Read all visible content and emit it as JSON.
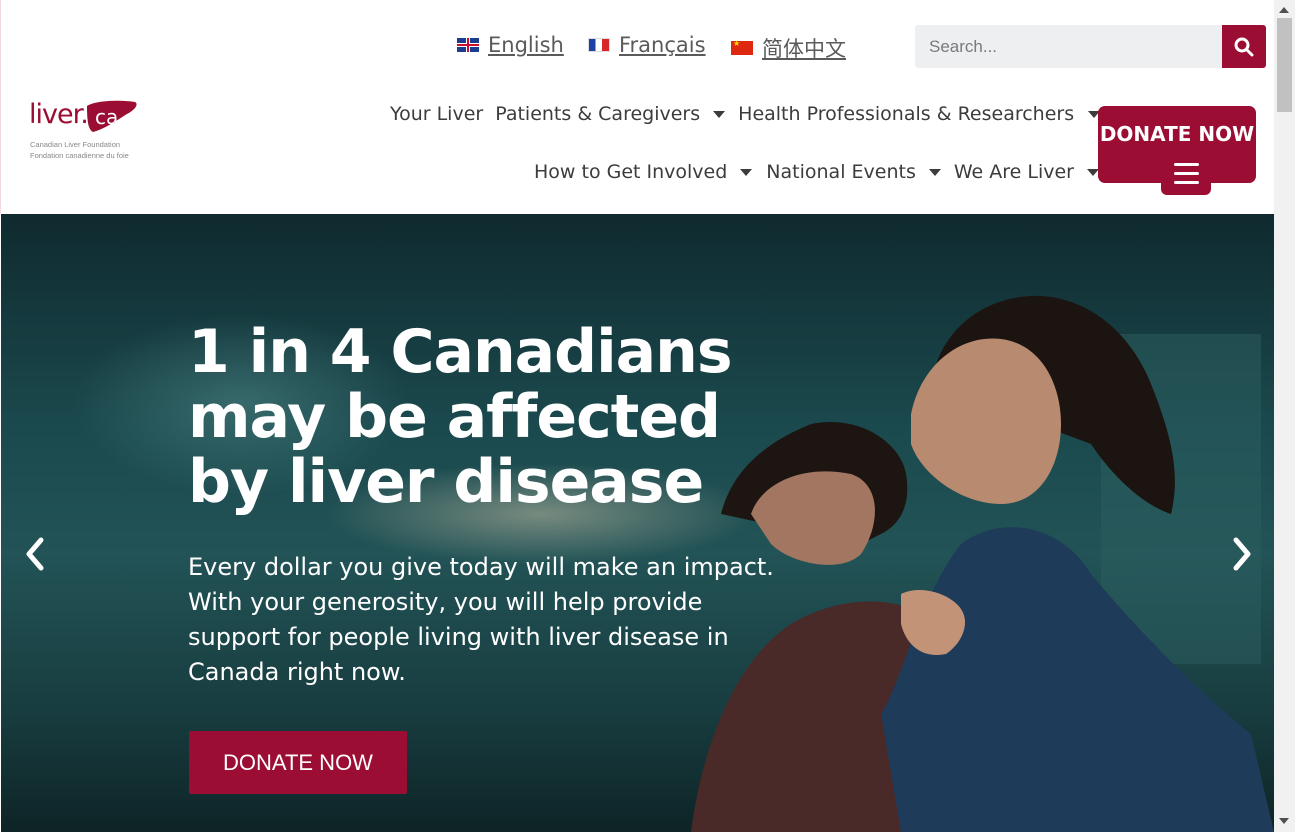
{
  "languages": [
    {
      "label": "English",
      "flag": "uk-flag-icon"
    },
    {
      "label": "Français",
      "flag": "france-flag-icon"
    },
    {
      "label": "简体中文",
      "flag": "china-flag-icon"
    }
  ],
  "search": {
    "placeholder": "Search...",
    "icon": "search-icon"
  },
  "logo": {
    "word": "liver.ca",
    "line1": "Canadian Liver Foundation",
    "line2": "Fondation canadienne du foie"
  },
  "nav": {
    "row1": [
      "Your Liver",
      "Patients & Caregivers",
      "Health Professionals & Researchers"
    ],
    "row2": [
      "How to Get Involved",
      "National Events",
      "We Are Liver"
    ]
  },
  "donate_top": "DONATE NOW",
  "hero": {
    "headline_1": "1 in 4 Canadians",
    "headline_2": "may be affected",
    "headline_3": "by liver disease",
    "body_1": "Every dollar you give today will make an impact.",
    "body_2": "With your generosity, you will help provide",
    "body_3": "support for people living with liver disease in",
    "body_4": "Canada right now.",
    "cta": "DONATE NOW"
  },
  "colors": {
    "brand": "#9b0d33",
    "nav_text": "#3c3c3c",
    "search_bg": "#eeeff1"
  }
}
